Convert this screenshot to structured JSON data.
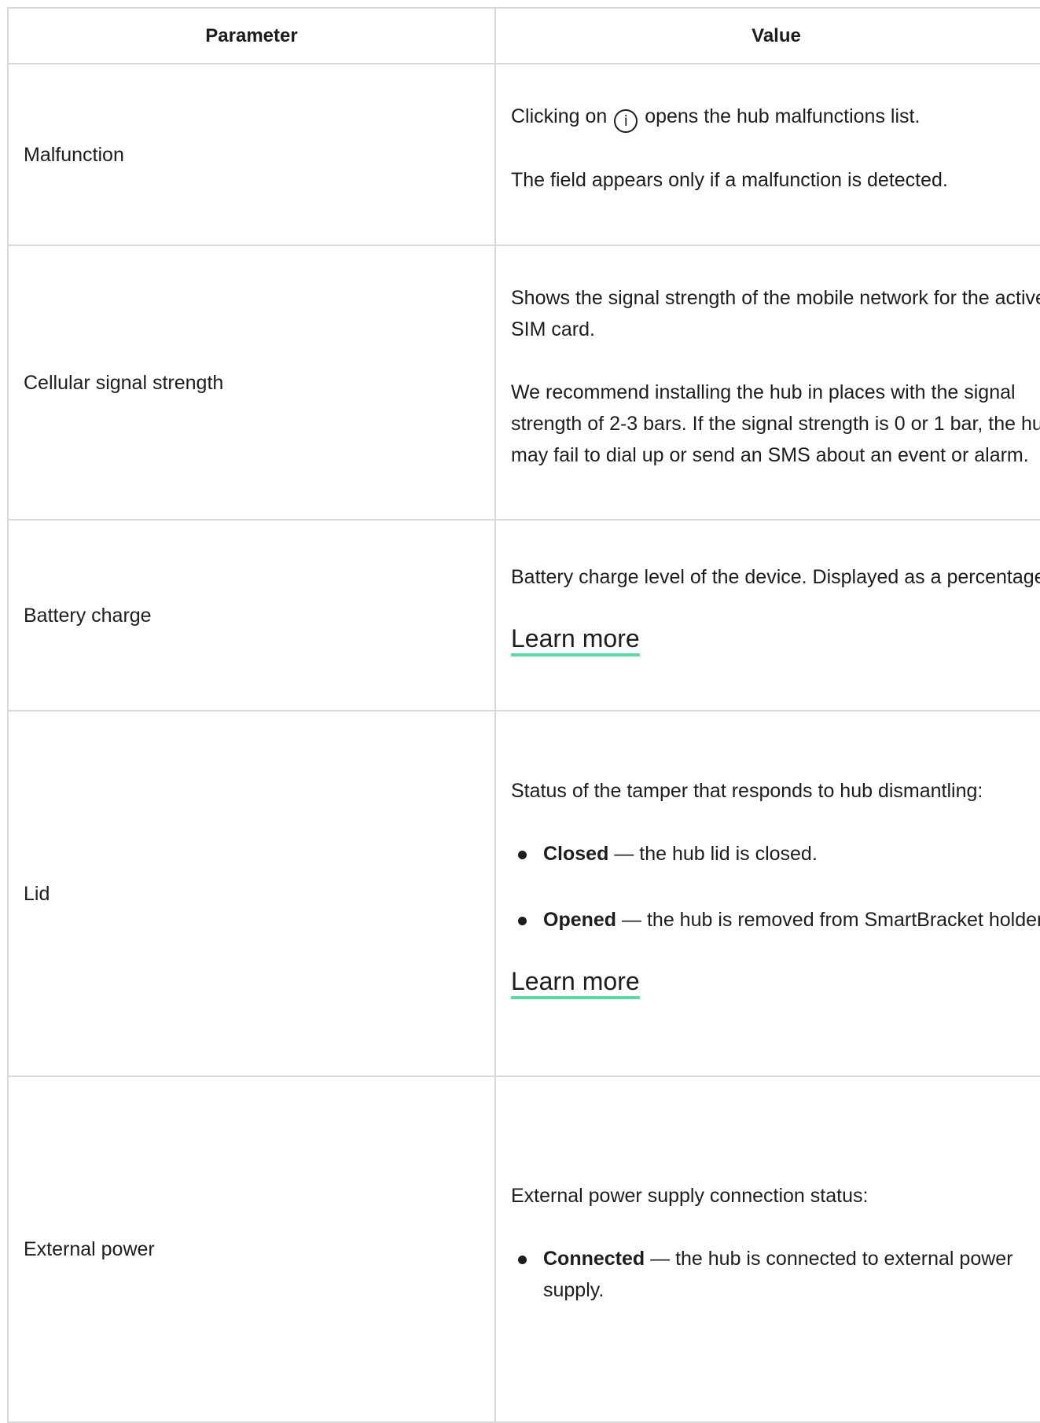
{
  "table": {
    "headers": {
      "parameter": "Parameter",
      "value": "Value"
    },
    "rows": {
      "malfunction": {
        "param": "Malfunction",
        "text_before_icon": "Clicking on",
        "icon_glyph": "i",
        "icon_name": "info-icon",
        "text_after_icon": "opens the hub malfunctions list.",
        "note": "The field appears only if a malfunction is detected."
      },
      "cellular": {
        "param": "Cellular signal strength",
        "p1": "Shows the signal strength of the mobile network for the active SIM card.",
        "p2": "We recommend installing the hub in places with the signal strength of 2-3 bars. If the signal strength is 0 or 1 bar, the hub may fail to dial up or send an SMS about an event or alarm."
      },
      "battery": {
        "param": "Battery charge",
        "p1": "Battery charge level of the device. Displayed as a percentage.",
        "link": "Learn more"
      },
      "lid": {
        "param": "Lid",
        "p1": "Status of the tamper that responds to hub dismantling:",
        "items": [
          {
            "term": "Closed",
            "desc": " — the hub lid is closed."
          },
          {
            "term": "Opened",
            "desc": " — the hub is removed from SmartBracket holder."
          }
        ],
        "link": "Learn more"
      },
      "external_power": {
        "param": "External power",
        "p1": "External power supply connection status:",
        "items": [
          {
            "term": "Connected",
            "desc": " — the hub is connected to external power supply."
          }
        ]
      }
    },
    "colors": {
      "border": "#d9d9d9",
      "link_underline": "#5fd8a6",
      "text": "#1d1d1d"
    }
  }
}
